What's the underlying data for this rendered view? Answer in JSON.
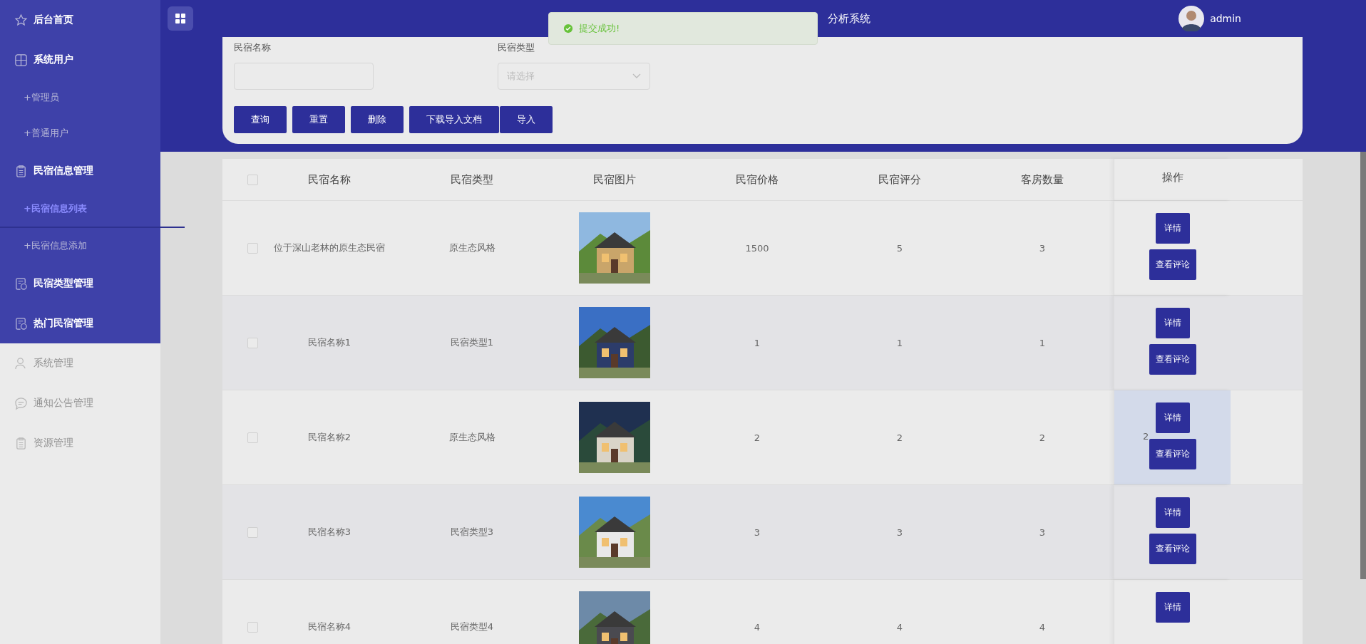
{
  "sidebar": {
    "groups": [
      {
        "items": [
          {
            "label": "后台首页",
            "kind": "menu",
            "selected": false
          },
          {
            "label": "系统用户",
            "kind": "menu",
            "selected": false
          },
          {
            "label": "+管理员",
            "kind": "submenu",
            "selected": false
          },
          {
            "label": "+普通用户",
            "kind": "submenu",
            "selected": false
          },
          {
            "label": "民宿信息管理",
            "kind": "menu",
            "selected": false
          },
          {
            "label": "+民宿信息列表",
            "kind": "submenu",
            "selected": true
          },
          {
            "label": "+民宿信息添加",
            "kind": "submenu",
            "selected": false
          },
          {
            "label": "民宿类型管理",
            "kind": "menu",
            "selected": false
          },
          {
            "label": "热门民宿管理",
            "kind": "menu",
            "selected": false
          }
        ]
      },
      {
        "items": [
          {
            "label": "系统管理",
            "kind": "menu",
            "selected": false
          },
          {
            "label": "通知公告管理",
            "kind": "menu",
            "selected": false
          },
          {
            "label": "资源管理",
            "kind": "menu",
            "selected": false
          }
        ]
      }
    ]
  },
  "header": {
    "title": "分析系统",
    "user": "admin"
  },
  "toast": {
    "message": "提交成功!"
  },
  "filters": [
    {
      "label": "民宿名称",
      "kind": "text"
    },
    {
      "label": "民宿类型",
      "kind": "select",
      "placeholder": "请选择"
    }
  ],
  "buttons": [
    "查询",
    "重置",
    "删除",
    "下载导入文档",
    "导入"
  ],
  "table": {
    "all_checked": false,
    "columns": [
      "民宿名称",
      "民宿类型",
      "民宿图片",
      "民宿价格",
      "民宿评分",
      "客房数量",
      "操作"
    ],
    "rows": [
      {
        "name": "位于深山老林的原生态民宿",
        "type": "原生态风格",
        "price": "1500",
        "score": "5",
        "rooms": "3",
        "hovered": false,
        "checked": false,
        "actions": [
          "详情",
          "查看评论"
        ]
      },
      {
        "name": "民宿名称1",
        "type": "民宿类型1",
        "price": "1",
        "score": "1",
        "rooms": "1",
        "hovered": false,
        "checked": false,
        "actions": [
          "详情",
          "查看评论"
        ]
      },
      {
        "name": "民宿名称2",
        "type": "原生态风格",
        "price": "2",
        "score": "2",
        "rooms": "2",
        "hovered": true,
        "checked": false,
        "extra": "2",
        "actions": [
          "详情",
          "查看评论"
        ]
      },
      {
        "name": "民宿名称3",
        "type": "民宿类型3",
        "price": "3",
        "score": "3",
        "rooms": "3",
        "hovered": false,
        "checked": false,
        "actions": [
          "详情",
          "查看评论"
        ]
      },
      {
        "name": "民宿名称4",
        "type": "民宿类型4",
        "price": "4",
        "score": "4",
        "rooms": "4",
        "hovered": false,
        "checked": false,
        "actions": [
          "详情"
        ]
      }
    ]
  }
}
